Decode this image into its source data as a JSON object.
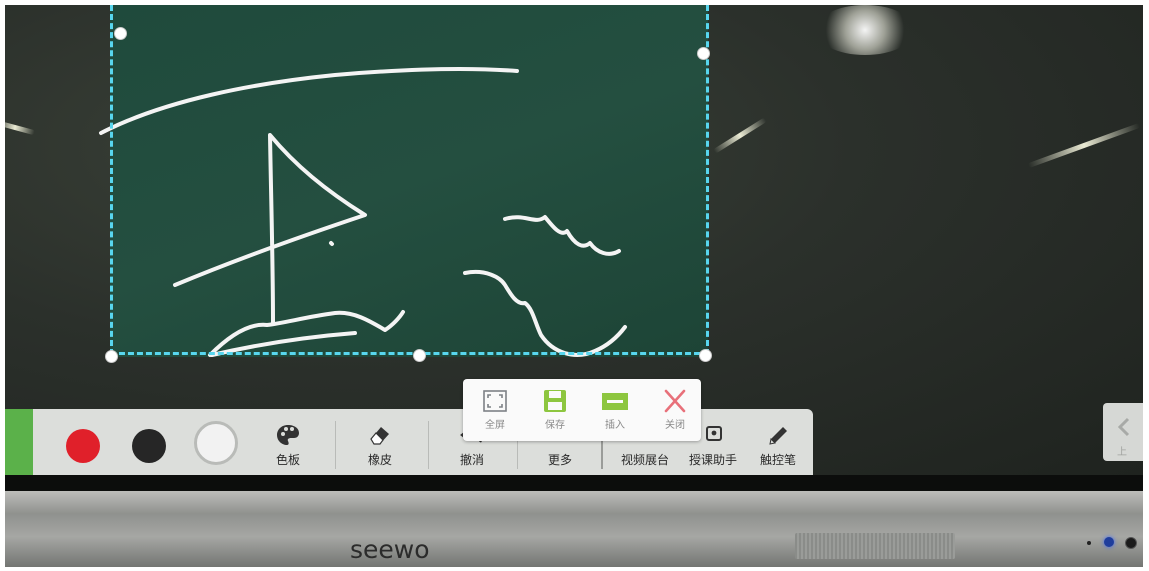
{
  "palette": {
    "colors": [
      {
        "name": "red",
        "hex": "#e0202a"
      },
      {
        "name": "black",
        "hex": "#262626"
      },
      {
        "name": "white",
        "hex": "#f2f2f2"
      }
    ],
    "accent_selection": "#58d6ee",
    "board_color": "#234c3e",
    "toolbar_green": "#5bb14a"
  },
  "toolbar": {
    "color_panel_label": "色板",
    "eraser_label": "橡皮",
    "undo_label": "撤消",
    "more_label": "更多",
    "video_booth_label": "视频展台",
    "teaching_assistant_label": "授课助手",
    "touch_pen_label": "触控笔"
  },
  "popup": {
    "fullscreen_label": "全屏",
    "save_label": "保存",
    "insert_label": "插入",
    "close_label": "关闭"
  },
  "side_tab": {
    "label": "上"
  },
  "device": {
    "brand": "seewo"
  }
}
